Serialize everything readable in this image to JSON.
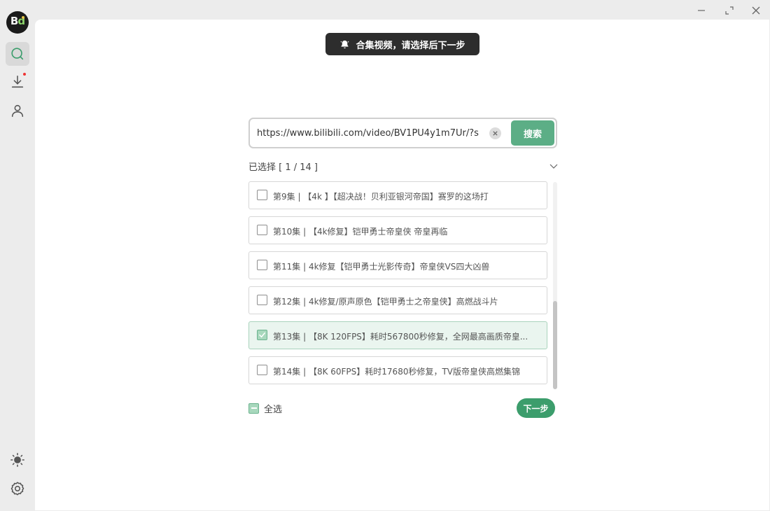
{
  "app": {
    "logo_text": "Bd"
  },
  "sidebar": {
    "items": [
      {
        "name": "search",
        "icon": "search-icon",
        "active": true
      },
      {
        "name": "download",
        "icon": "download-icon",
        "badge": true
      },
      {
        "name": "user",
        "icon": "user-icon"
      }
    ],
    "bottom": [
      {
        "name": "theme",
        "icon": "sun-icon"
      },
      {
        "name": "settings",
        "icon": "gear-icon"
      }
    ]
  },
  "window_controls": [
    "minimize",
    "restore",
    "close"
  ],
  "toast": {
    "icon": "bell-icon",
    "text": "合集视频，请选择后下一步"
  },
  "search": {
    "value": "https://www.bilibili.com/video/BV1PU4y1m7Ur/?s",
    "button_label": "搜索"
  },
  "selection": {
    "summary": "已选择 [ 1 / 14 ]"
  },
  "episodes": [
    {
      "title": "第9集 | 【4k 】【超决战！贝利亚银河帝国】赛罗的这场打",
      "checked": false
    },
    {
      "title": "第10集 | 【4k修复】铠甲勇士帝皇侠 帝皇再临",
      "checked": false
    },
    {
      "title": "第11集 | 4k修复【铠甲勇士光影传奇】帝皇侠VS四大凶兽",
      "checked": false
    },
    {
      "title": "第12集 | 4k修复/原声原色【铠甲勇士之帝皇侠】高燃战斗片",
      "checked": false
    },
    {
      "title": "第13集 | 【8K 120FPS】耗时567800秒修复，全网最高画质帝皇...",
      "checked": true
    },
    {
      "title": "第14集 | 【8K 60FPS】耗时17680秒修复，TV版帝皇侠高燃集锦",
      "checked": false
    }
  ],
  "footer": {
    "select_all_label": "全选",
    "next_label": "下一步"
  },
  "colors": {
    "accent": "#5cae86",
    "next_button": "#3c9d6c",
    "toast_bg": "#2d2d2d",
    "selected_bg": "#eaf5ef"
  }
}
